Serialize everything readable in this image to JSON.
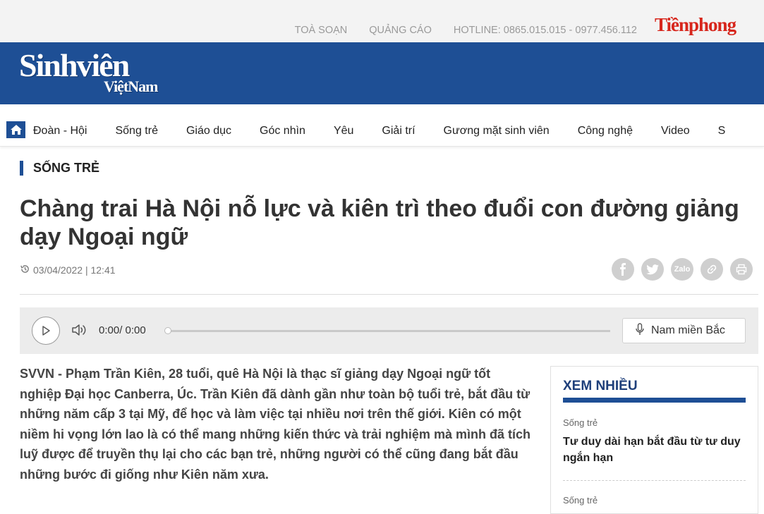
{
  "topbar": {
    "links": [
      "TOÀ SOẠN",
      "QUẢNG CÁO",
      "HOTLINE: 0865.015.015 - 0977.456.112"
    ],
    "partner_logo": "Tiềnphong"
  },
  "logo": {
    "line1": "Sinhviên",
    "line2": "ViệtNam"
  },
  "nav": {
    "home_icon": "home-icon",
    "items": [
      "Đoàn - Hội",
      "Sống trẻ",
      "Giáo dục",
      "Góc nhìn",
      "Yêu",
      "Giải trí",
      "Gương mặt sinh viên",
      "Công nghệ",
      "Video",
      "S"
    ]
  },
  "article": {
    "category": "SỐNG TRẺ",
    "title": "Chàng trai Hà Nội nỗ lực và kiên trì theo đuổi con đường giảng dạy Ngoại ngữ",
    "date": "03/04/2022 | 12:41",
    "share_icons": [
      "facebook-icon",
      "twitter-icon",
      "zalo-icon",
      "link-icon",
      "print-icon"
    ],
    "zalo_label": "Zalo",
    "lead": "SVVN - Phạm Trần Kiên, 28 tuổi, quê Hà Nội là thạc sĩ giảng dạy Ngoại ngữ tốt nghiệp Đại học Canberra, Úc. Trần Kiên đã dành gần như toàn bộ tuổi trẻ, bắt đầu từ những năm cấp 3 tại Mỹ, để học và làm việc tại nhiều nơi trên thế giới. Kiên có một niềm hi vọng lớn lao là có thể mang những kiến thức và trải nghiệm mà mình đã tích luỹ được để truyền thụ lại cho các bạn trẻ, những người có thể cũng đang bắt đầu những bước đi giống như Kiên năm xưa."
  },
  "audio": {
    "time": "0:00/ 0:00",
    "progress": 0,
    "voice_label": "Nam miền Bắc"
  },
  "sidebar": {
    "heading": "XEM NHIỀU",
    "items": [
      {
        "category": "Sống trẻ",
        "title": "Tư duy dài hạn bắt đầu từ tư duy ngắn hạn"
      },
      {
        "category": "Sống trẻ",
        "title": ""
      }
    ]
  },
  "colors": {
    "brand_blue": "#1e4f95",
    "tienphong_red": "#d7261c"
  }
}
